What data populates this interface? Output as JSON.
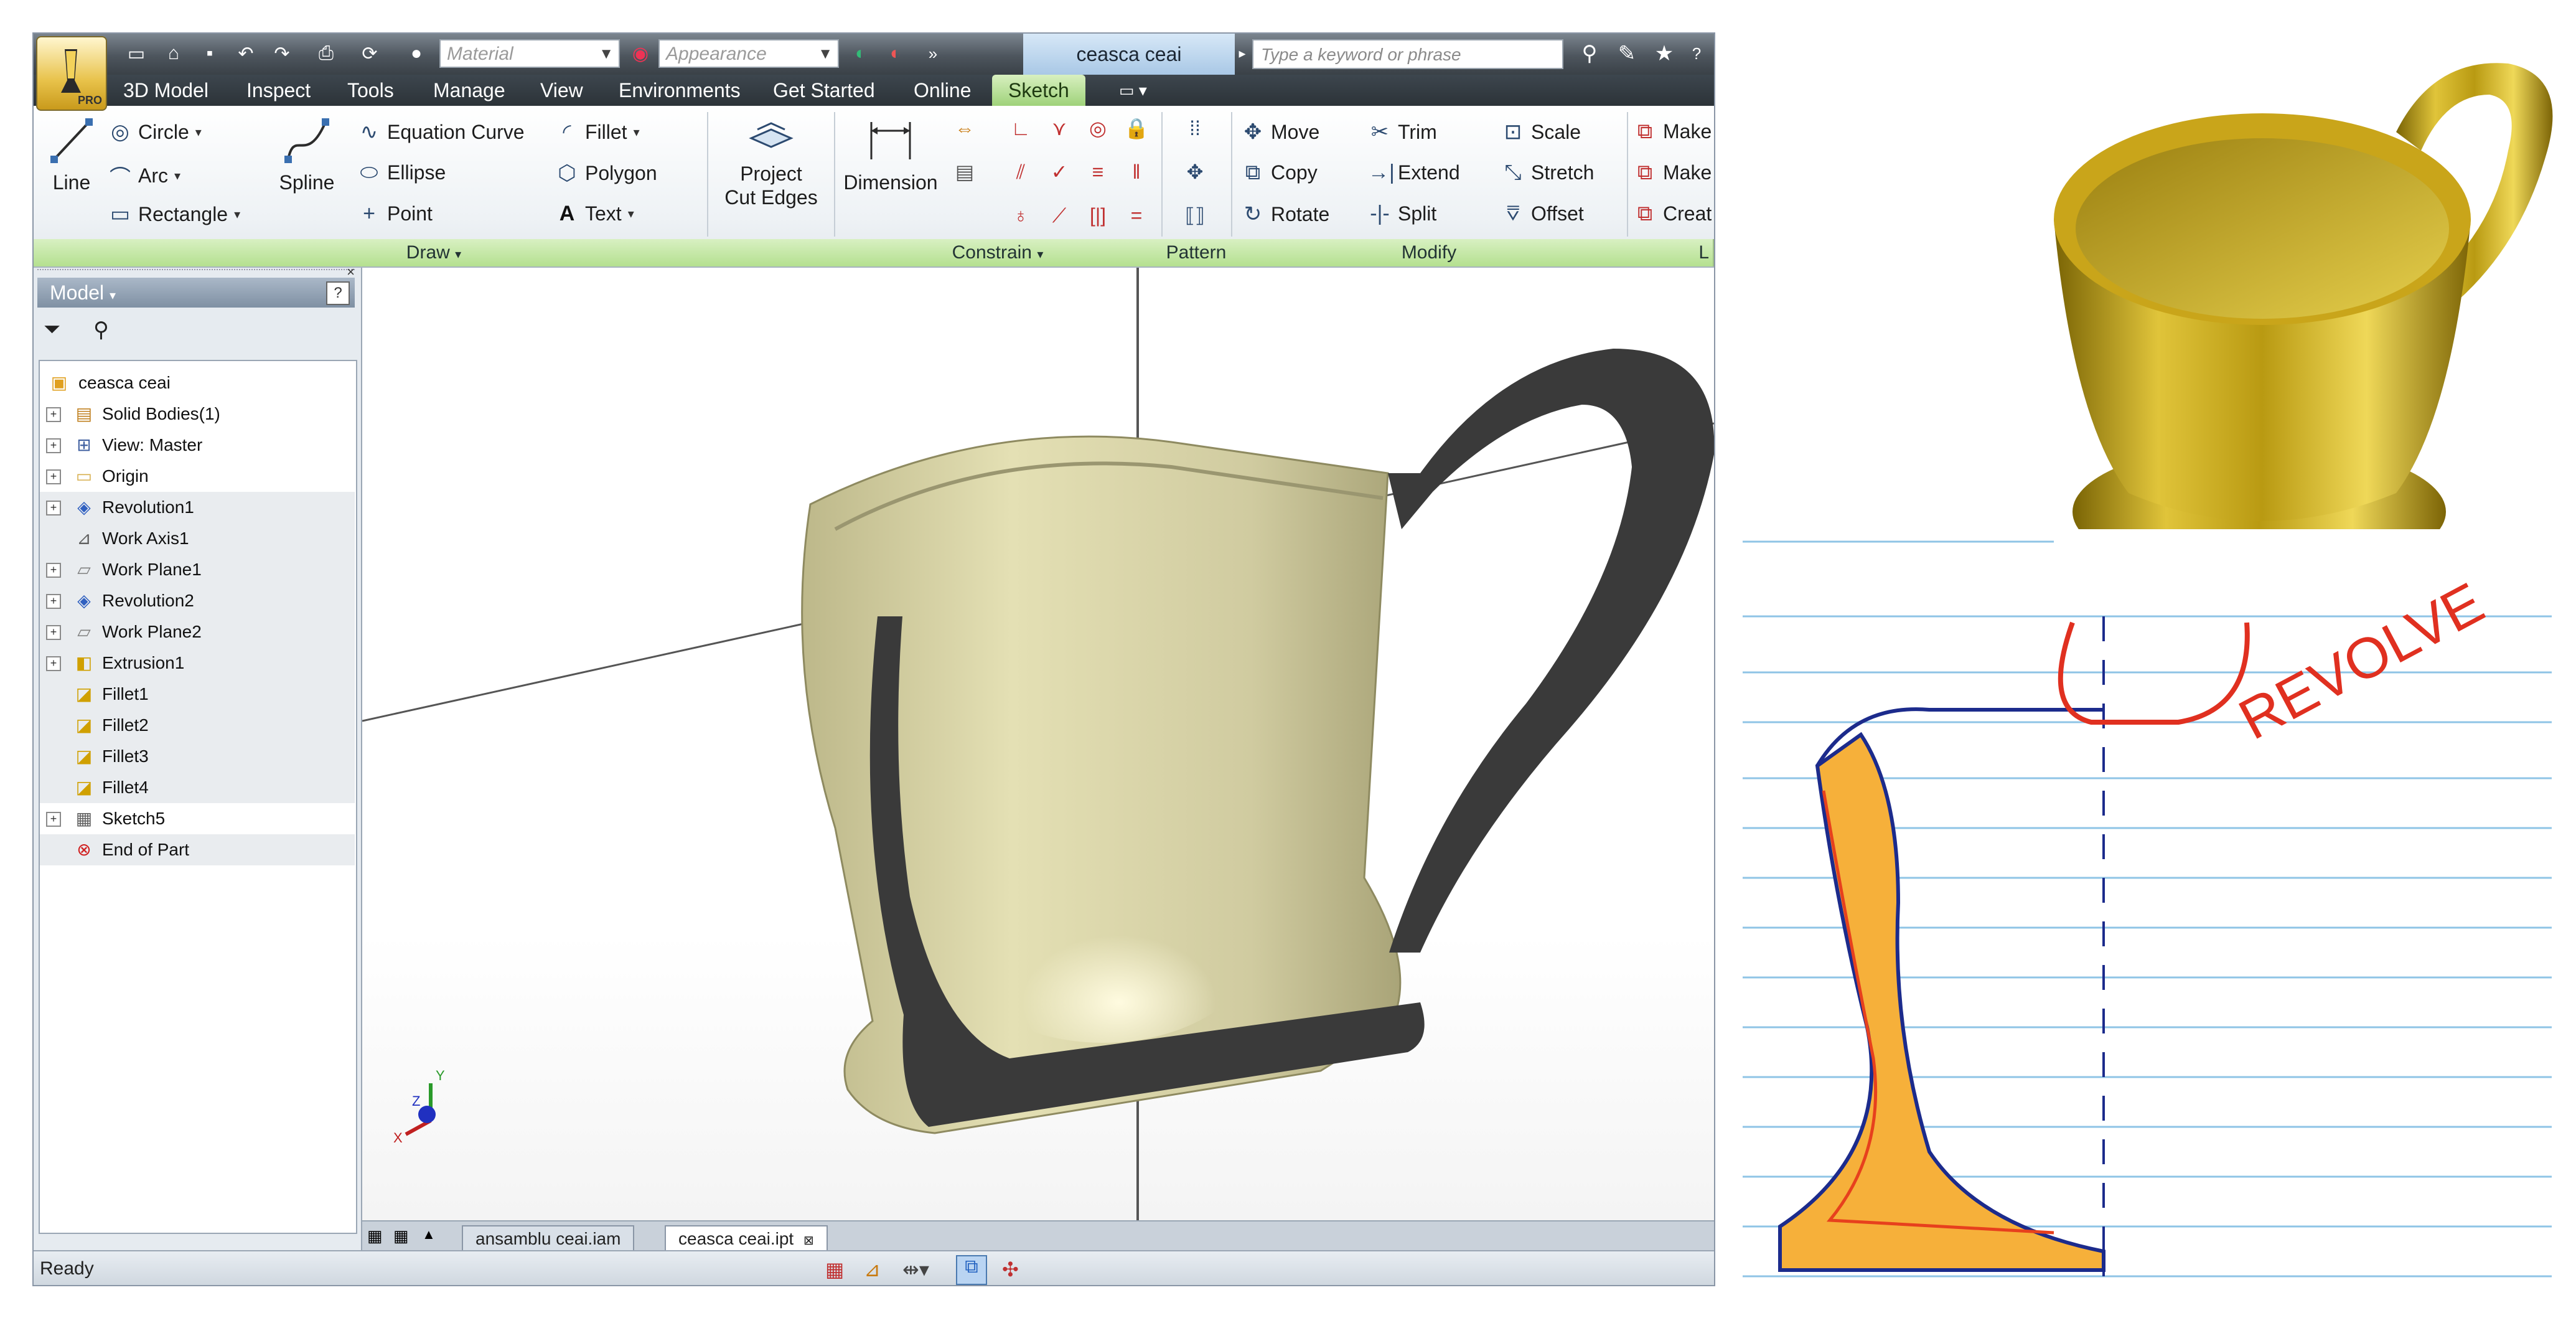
{
  "quick_access": {
    "material_placeholder": "Material",
    "appearance_placeholder": "Appearance",
    "document_title": "ceasca ceai",
    "search_placeholder": "Type a keyword or phrase",
    "app_badge": "PRO"
  },
  "ribbon_tabs": [
    "3D Model",
    "Inspect",
    "Tools",
    "Manage",
    "View",
    "Environments",
    "Get Started",
    "Online",
    "Sketch"
  ],
  "active_tab": "Sketch",
  "ribbon": {
    "draw": {
      "line": "Line",
      "circle": "Circle",
      "arc": "Arc",
      "rectangle": "Rectangle",
      "spline": "Spline",
      "equation_curve": "Equation Curve",
      "ellipse": "Ellipse",
      "point": "Point",
      "fillet": "Fillet",
      "polygon": "Polygon",
      "text": "Text",
      "project_line1": "Project",
      "project_line2": "Cut Edges"
    },
    "constrain": {
      "dimension": "Dimension"
    },
    "modify": {
      "move": "Move",
      "copy": "Copy",
      "rotate": "Rotate",
      "trim": "Trim",
      "extend": "Extend",
      "split": "Split",
      "scale": "Scale",
      "stretch": "Stretch",
      "offset": "Offset"
    },
    "layout": {
      "make1": "Make",
      "make2": "Make",
      "create": "Creat"
    },
    "panels": {
      "draw": "Draw",
      "constrain": "Constrain",
      "pattern": "Pattern",
      "modify": "Modify",
      "layout": "L"
    }
  },
  "browser": {
    "title": "Model",
    "help": "?",
    "tree": [
      {
        "label": "ceasca ceai",
        "icon": "part-icon"
      },
      {
        "label": "Solid Bodies(1)",
        "icon": "solid-bodies-icon"
      },
      {
        "label": "View: Master",
        "icon": "view-icon"
      },
      {
        "label": "Origin",
        "icon": "folder-icon"
      },
      {
        "label": "Revolution1",
        "icon": "revolve-icon"
      },
      {
        "label": "Work Axis1",
        "icon": "work-axis-icon"
      },
      {
        "label": "Work Plane1",
        "icon": "work-plane-icon"
      },
      {
        "label": "Revolution2",
        "icon": "revolve-icon"
      },
      {
        "label": "Work Plane2",
        "icon": "work-plane-icon"
      },
      {
        "label": "Extrusion1",
        "icon": "extrude-icon"
      },
      {
        "label": "Fillet1",
        "icon": "fillet-icon"
      },
      {
        "label": "Fillet2",
        "icon": "fillet-icon"
      },
      {
        "label": "Fillet3",
        "icon": "fillet-icon"
      },
      {
        "label": "Fillet4",
        "icon": "fillet-icon"
      },
      {
        "label": "Sketch5",
        "icon": "sketch-icon"
      },
      {
        "label": "End of Part",
        "icon": "end-of-part-icon"
      }
    ]
  },
  "document_tabs": [
    "ansamblu ceai.iam",
    "ceasca ceai.ipt"
  ],
  "active_document": "ceasca ceai.ipt",
  "status": {
    "text": "Ready"
  },
  "viewcube_axes": {
    "x": "X",
    "y": "Y",
    "z": "Z"
  },
  "sketch_note": "REVOLVE",
  "colors": {
    "ribbon_active_tab": "#9fd27a",
    "cup_render": "#c9a51a",
    "cup_section_model": "#d8d3a0",
    "section_cut": "#3a3a3a",
    "sketch_orange": "#f0a020",
    "sketch_red": "#e03020",
    "sketch_blue": "#1c2b8c"
  }
}
